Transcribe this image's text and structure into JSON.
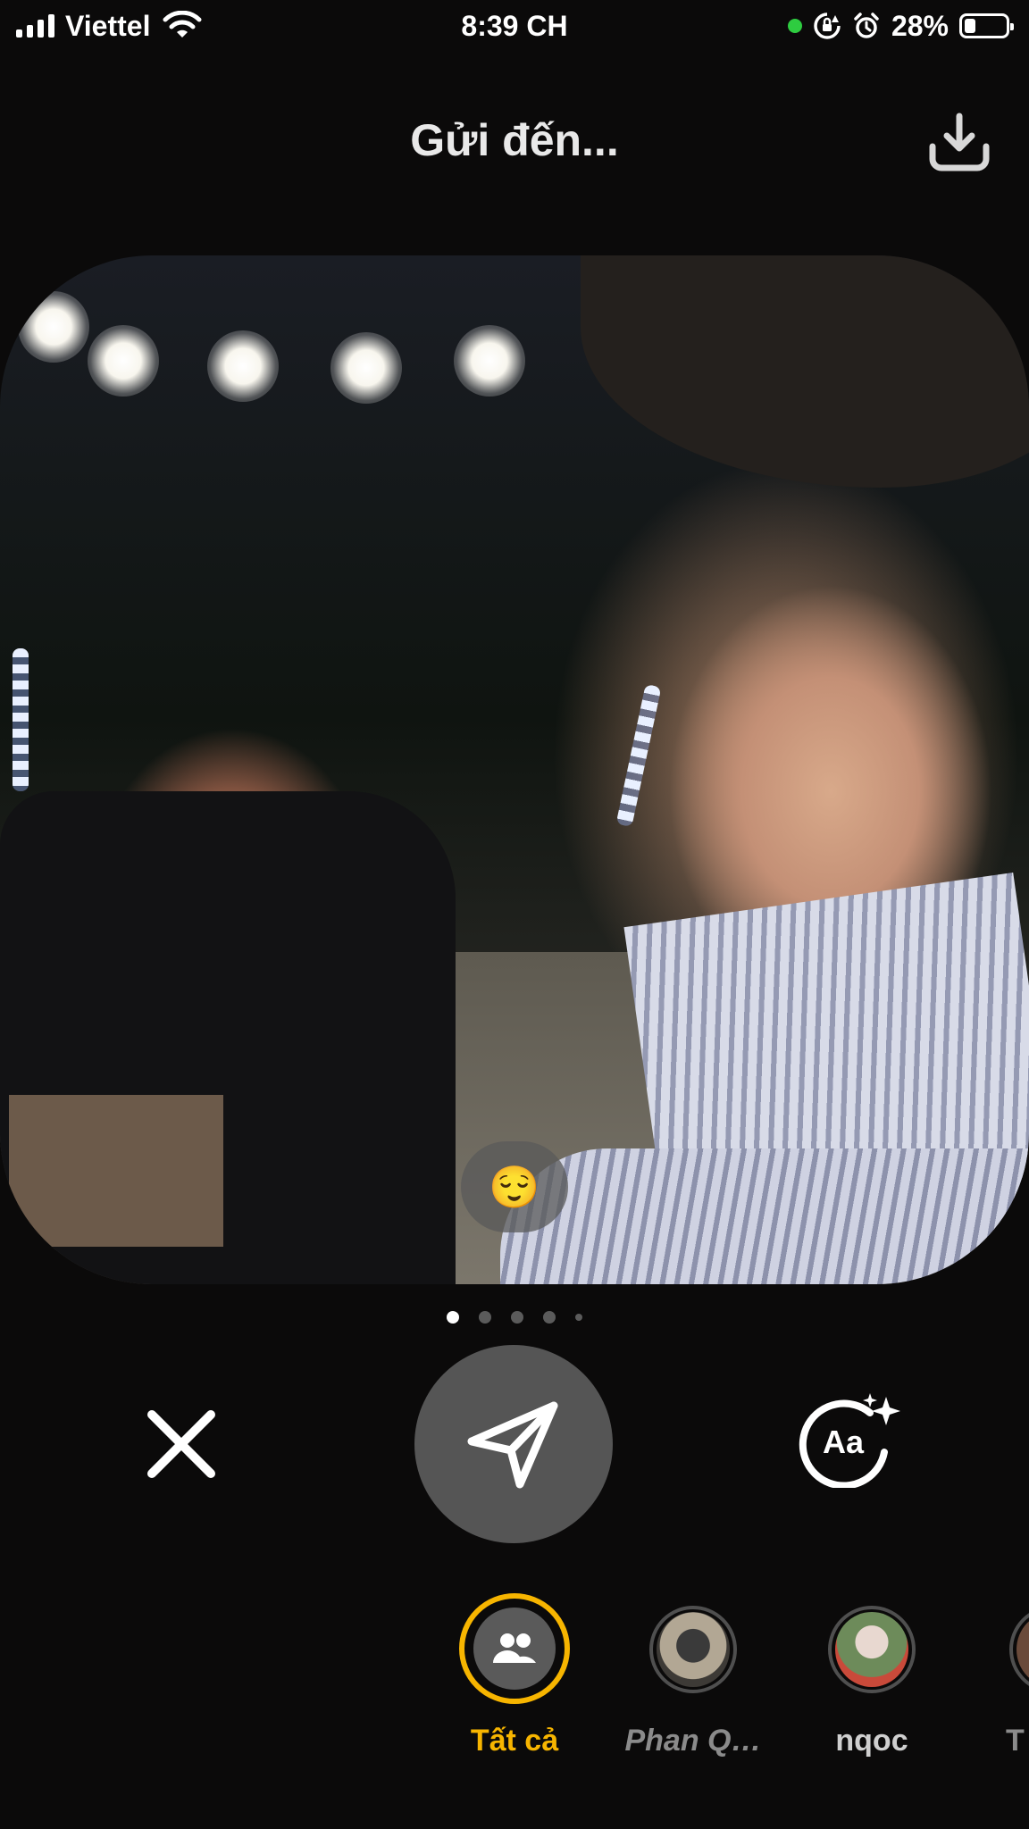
{
  "status_bar": {
    "carrier": "Viettel",
    "time": "8:39 CH",
    "battery_percent": "28%",
    "battery_level": 0.28,
    "icons": [
      "signal-icon",
      "wifi-icon",
      "camera-in-use-dot",
      "orientation-lock-icon",
      "alarm-icon",
      "battery-icon"
    ]
  },
  "header": {
    "title": "Gửi đến...",
    "download_icon": "download-icon"
  },
  "photo": {
    "reaction_emoji": "😌"
  },
  "pager": {
    "page_count": 5,
    "current_page": 1
  },
  "controls": {
    "close_icon": "close-icon",
    "send_icon": "send-icon",
    "caption_icon": "caption-text-icon",
    "caption_glyph": "Aa"
  },
  "recipients": [
    {
      "name": "Tất cả",
      "selected": true,
      "icon": "group-icon"
    },
    {
      "name": "Phan Q…",
      "selected": false
    },
    {
      "name": "nqoc",
      "selected": false
    },
    {
      "name": "T",
      "selected": false
    }
  ],
  "colors": {
    "accent": "#f7b500",
    "background": "#0b0a0a",
    "send_button": "#555555"
  }
}
